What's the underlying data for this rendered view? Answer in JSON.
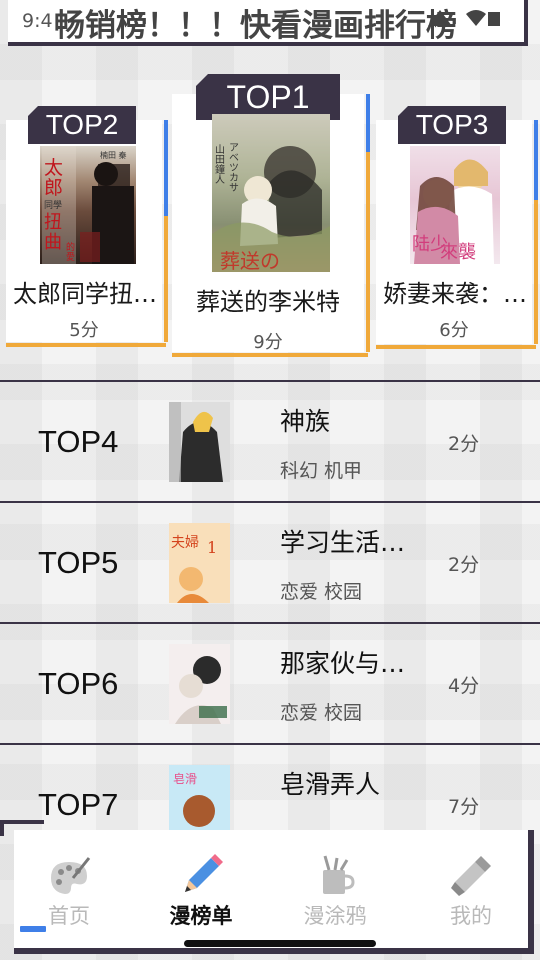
{
  "status_bar": {
    "time": "9:4"
  },
  "page_title": "畅销榜！！！快看漫画排行榜",
  "podium": [
    {
      "rank": "TOP1",
      "title": "葬送的李米特",
      "score": "9分",
      "cover_text": "葬送のフリーレン"
    },
    {
      "rank": "TOP2",
      "title": "太郎同学扭…",
      "score": "5分",
      "cover_text": "太郎同学扭曲的爱"
    },
    {
      "rank": "TOP3",
      "title": "娇妻来袭：…",
      "score": "6分",
      "cover_text": "陆少娇妻来袭"
    }
  ],
  "list": [
    {
      "rank": "TOP4",
      "title": "神族",
      "tags": "科幻 机甲",
      "score": "2分"
    },
    {
      "rank": "TOP5",
      "title": "学习生活…",
      "tags": "恋爱 校园",
      "score": "2分"
    },
    {
      "rank": "TOP6",
      "title": "那家伙与…",
      "tags": "恋爱 校园",
      "score": "4分"
    },
    {
      "rank": "TOP7",
      "title": "皂滑弄人",
      "tags": "",
      "score": "7分"
    }
  ],
  "nav": {
    "items": [
      {
        "label": "首页",
        "icon": "palette-icon",
        "active": false
      },
      {
        "label": "漫榜单",
        "icon": "pencil-icon",
        "active": true
      },
      {
        "label": "漫涂鸦",
        "icon": "brush-cup-icon",
        "active": false
      },
      {
        "label": "我的",
        "icon": "paint-tube-icon",
        "active": false
      }
    ]
  },
  "colors": {
    "dark": "#3a3346",
    "orange": "#f0a93a",
    "blue": "#3f7fe8"
  }
}
